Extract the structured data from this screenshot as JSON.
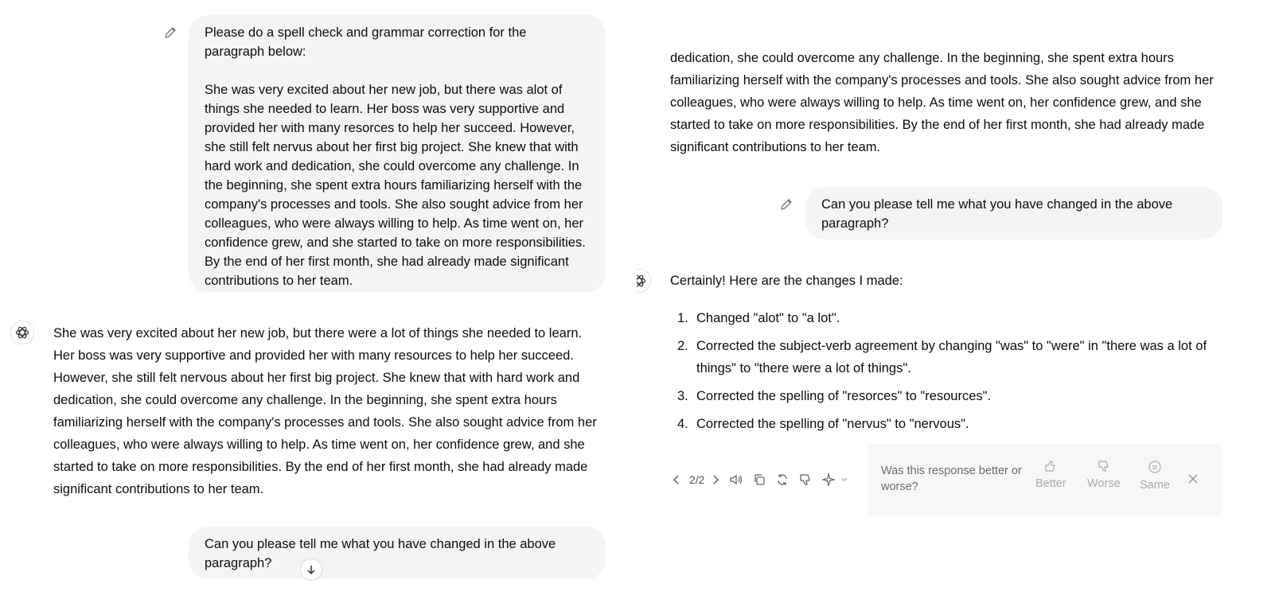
{
  "left": {
    "user_prompt": "Please do a spell check and grammar correction for the paragraph below:\n\nShe was very excited about her new job, but there was alot of things she needed to learn. Her boss was very supportive and provided her with many resorces to help her succeed. However, she still felt nervus about her first big project. She knew that with hard work and dedication, she could overcome any challenge. In the beginning, she spent extra hours familiarizing herself with the company's processes and tools. She also sought advice from her colleagues, who were always willing to help. As time went on, her confidence grew, and she started to take on more responsibilities. By the end of her first month, she had already made significant contributions to her team.",
    "assistant_reply": "She was very excited about her new job, but there were a lot of things she needed to learn. Her boss was very supportive and provided her with many resources to help her succeed. However, she still felt nervous about her first big project. She knew that with hard work and dedication, she could overcome any challenge. In the beginning, she spent extra hours familiarizing herself with the company's processes and tools. She also sought advice from her colleagues, who were always willing to help. As time went on, her confidence grew, and she started to take on more responsibilities. By the end of her first month, she had already made significant contributions to her team.",
    "followup_prompt": "Can you please tell me what you have changed in the above paragraph?"
  },
  "right": {
    "reply_tail": "dedication, she could overcome any challenge. In the beginning, she spent extra hours familiarizing herself with the company's processes and tools. She also sought advice from her colleagues, who were always willing to help. As time went on, her confidence grew, and she started to take on more responsibilities. By the end of her first month, she had already made significant contributions to her team.",
    "followup_prompt": "Can you please tell me what you have changed in the above paragraph?",
    "answer_intro": "Certainly! Here are the changes I made:",
    "changes": [
      {
        "num": "1.",
        "text": "Changed \"alot\" to \"a lot\"."
      },
      {
        "num": "2.",
        "text": "Corrected the subject-verb agreement by changing \"was\" to \"were\" in \"there was a lot of things\" to \"there were a lot of things\"."
      },
      {
        "num": "3.",
        "text": "Corrected the spelling of \"resorces\" to \"resources\"."
      },
      {
        "num": "4.",
        "text": "Corrected the spelling of \"nervus\" to \"nervous\"."
      }
    ],
    "pager": "2/2",
    "feedback": {
      "question": "Was this response better or worse?",
      "better": "Better",
      "worse": "Worse",
      "same": "Same"
    }
  },
  "icons": [
    "edit-icon",
    "assistant-logo-icon",
    "chevron-left-icon",
    "chevron-right-icon",
    "read-aloud-icon",
    "copy-icon",
    "regenerate-icon",
    "thumbs-down-icon",
    "sparkle-icon",
    "chevron-down-icon",
    "thumbs-up-icon",
    "neutral-face-icon",
    "close-icon",
    "arrow-down-icon"
  ],
  "colors": {
    "bubble": "#f4f4f4",
    "text": "#0d0d0d",
    "muted": "#a8a8a8"
  }
}
